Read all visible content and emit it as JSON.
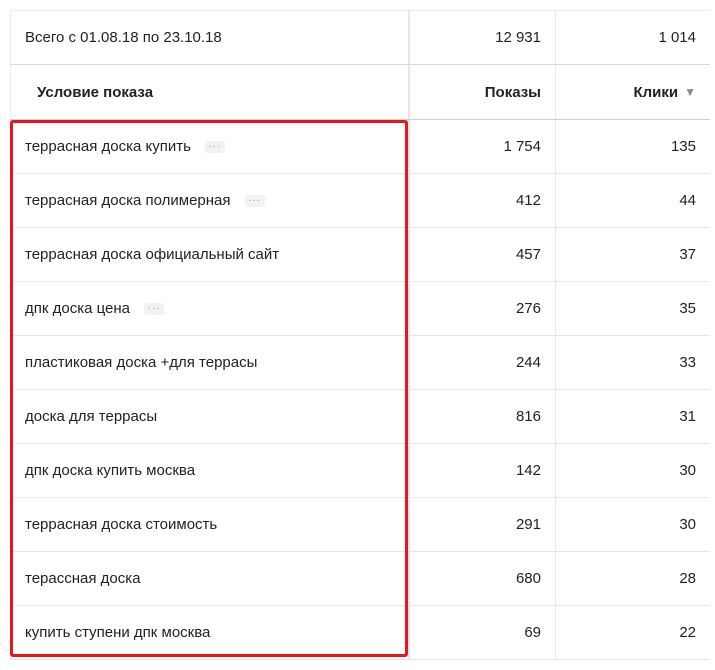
{
  "summary": {
    "label": "Всего с 01.08.18 по 23.10.18",
    "impressions": "12 931",
    "clicks": "1 014"
  },
  "columns": {
    "condition": "Условие показа",
    "impressions": "Показы",
    "clicks": "Клики",
    "sort_indicator": "▼"
  },
  "rows": [
    {
      "condition": "террасная доска купить",
      "impressions": "1 754",
      "clicks": "135",
      "more": "···"
    },
    {
      "condition": "террасная доска полимерная",
      "impressions": "412",
      "clicks": "44",
      "more": "···"
    },
    {
      "condition": "террасная доска официальный сайт",
      "impressions": "457",
      "clicks": "37"
    },
    {
      "condition": "дпк доска цена",
      "impressions": "276",
      "clicks": "35",
      "more": "···"
    },
    {
      "condition": "пластиковая доска +для террасы",
      "impressions": "244",
      "clicks": "33"
    },
    {
      "condition": "доска для террасы",
      "impressions": "816",
      "clicks": "31"
    },
    {
      "condition": "дпк доска купить москва",
      "impressions": "142",
      "clicks": "30"
    },
    {
      "condition": "террасная доска стоимость",
      "impressions": "291",
      "clicks": "30"
    },
    {
      "condition": "терассная доска",
      "impressions": "680",
      "clicks": "28"
    },
    {
      "condition": "купить ступени дпк москва",
      "impressions": "69",
      "clicks": "22"
    }
  ],
  "colors": {
    "highlight": "#e8151b",
    "border": "#e6e6e6",
    "text": "#222222"
  }
}
